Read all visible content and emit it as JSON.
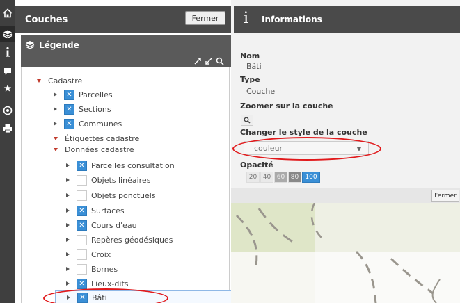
{
  "layers_panel": {
    "title": "Couches",
    "close_label": "Fermer",
    "legend_title": "Légende",
    "tree": [
      {
        "label": "Cadastre",
        "level": 0,
        "expanded": true,
        "checkbox": "none"
      },
      {
        "label": "Parcelles",
        "level": 1,
        "expanded": false,
        "checkbox": "checked"
      },
      {
        "label": "Sections",
        "level": 1,
        "expanded": false,
        "checkbox": "checked"
      },
      {
        "label": "Communes",
        "level": 1,
        "expanded": false,
        "checkbox": "checked"
      },
      {
        "label": "Étiquettes cadastre",
        "level": 0,
        "expanded": true,
        "checkbox": "none"
      },
      {
        "label": "Données cadastre",
        "level": 0,
        "expanded": true,
        "checkbox": "none"
      },
      {
        "label": "Parcelles consultation",
        "level": 2,
        "expanded": false,
        "checkbox": "checked"
      },
      {
        "label": "Objets linéaires",
        "level": 2,
        "expanded": false,
        "checkbox": "unchecked"
      },
      {
        "label": "Objets ponctuels",
        "level": 2,
        "expanded": false,
        "checkbox": "unchecked"
      },
      {
        "label": "Surfaces",
        "level": 2,
        "expanded": false,
        "checkbox": "checked"
      },
      {
        "label": "Cours d'eau",
        "level": 2,
        "expanded": false,
        "checkbox": "checked"
      },
      {
        "label": "Repères géodésiques",
        "level": 2,
        "expanded": false,
        "checkbox": "unchecked"
      },
      {
        "label": "Croix",
        "level": 2,
        "expanded": false,
        "checkbox": "unchecked"
      },
      {
        "label": "Bornes",
        "level": 2,
        "expanded": false,
        "checkbox": "unchecked"
      },
      {
        "label": "Lieux-dits",
        "level": 2,
        "expanded": false,
        "checkbox": "checked"
      },
      {
        "label": "Bâti",
        "level": 2,
        "expanded": false,
        "checkbox": "checked",
        "selected": true
      }
    ]
  },
  "info_panel": {
    "title": "Informations",
    "name_label": "Nom",
    "name_value": "Bâti",
    "type_label": "Type",
    "type_value": "Couche",
    "zoom_label": "Zoomer sur la couche",
    "style_label": "Changer le style de la couche",
    "style_value": "couleur",
    "opacity_label": "Opacité",
    "opacity_options": [
      "20",
      "40",
      "60",
      "80",
      "100"
    ],
    "opacity_selected": "100",
    "close_label": "Fermer"
  },
  "toolbar_icons": [
    "home-icon",
    "layers-icon",
    "info-icon",
    "comment-icon",
    "star-icon",
    "target-icon",
    "print-icon"
  ],
  "colors": {
    "accent": "#3a8fd6",
    "header_bg": "#4a4a4a",
    "tree_expanded_arrow": "#c0392b",
    "annotation": "#e1191b"
  }
}
